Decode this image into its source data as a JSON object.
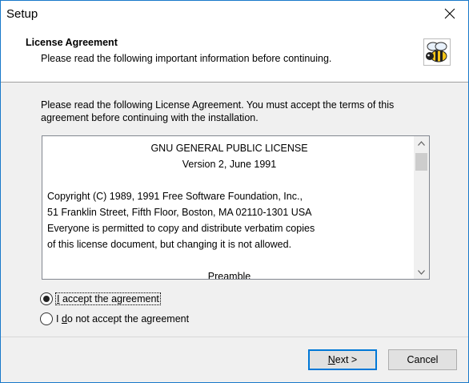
{
  "window": {
    "title": "Setup"
  },
  "header": {
    "title": "License Agreement",
    "subtitle": "Please read the following important information before continuing.",
    "logo_icon": "bee-icon"
  },
  "intro": {
    "line1": "Please read the following License Agreement. You must accept the terms of this",
    "line2": "agreement before continuing with the installation."
  },
  "license": {
    "lines": [
      "GNU GENERAL PUBLIC LICENSE",
      "Version 2, June 1991",
      "",
      "Copyright (C) 1989, 1991 Free Software Foundation, Inc.,",
      "51 Franklin Street, Fifth Floor, Boston, MA 02110-1301 USA",
      "Everyone is permitted to copy and distribute verbatim copies",
      "of this license document, but changing it is not allowed.",
      "",
      "Preamble"
    ]
  },
  "options": {
    "accept": {
      "label_pre": "",
      "label_u": "I",
      "label_post": " accept the agreement",
      "selected": true
    },
    "decline": {
      "label_pre": "I ",
      "label_u": "d",
      "label_post": "o not accept the agreement",
      "selected": false
    }
  },
  "buttons": {
    "next_u": "N",
    "next_rest": "ext >",
    "cancel": "Cancel"
  },
  "colors": {
    "border_accent": "#1979ca",
    "default_button": "#0078d7"
  }
}
